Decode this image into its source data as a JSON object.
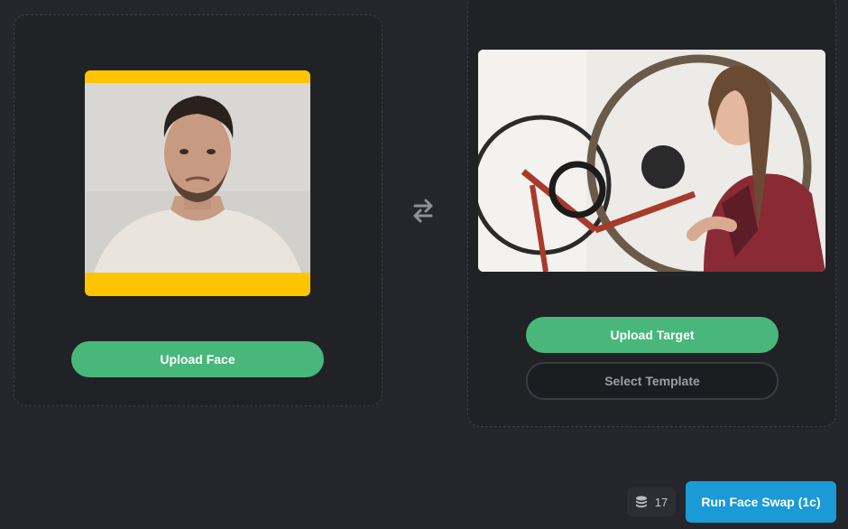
{
  "source": {
    "photo_icon": "face-photo",
    "upload_label": "Upload Face",
    "frame_color": "#ffc400"
  },
  "swap": {
    "icon": "swap-arrows-icon"
  },
  "target": {
    "photo_icon": "target-photo",
    "upload_label": "Upload Target",
    "template_label": "Select Template"
  },
  "footer": {
    "credits_icon": "coins-stack-icon",
    "credits": "17",
    "run_label": "Run Face Swap (1c)"
  },
  "colors": {
    "background": "#24262b",
    "panel": "#202226",
    "accent_green": "#49b77b",
    "accent_blue": "#1a9ad6"
  }
}
